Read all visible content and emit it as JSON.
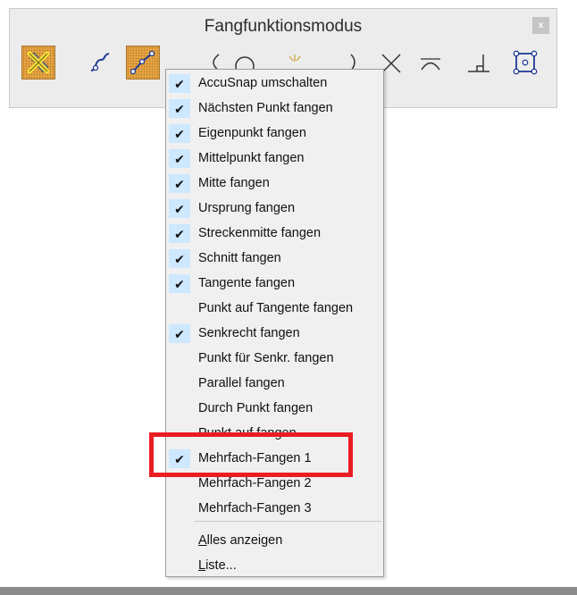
{
  "window": {
    "title": "Fangfunktionsmodus",
    "close_label": "x"
  },
  "toolbar": {
    "tools": [
      {
        "icon": "snap-toggle-icon",
        "active": true
      },
      {
        "icon": "nearest-point-icon",
        "active": false
      },
      {
        "icon": "keypoint-snap-icon",
        "active": true
      },
      {
        "icon": "midpoint-arc-icon",
        "active": false
      },
      {
        "icon": "center-circle-icon",
        "active": false
      },
      {
        "icon": "origin-icon",
        "active": false
      },
      {
        "icon": "bisector-icon",
        "active": false
      },
      {
        "icon": "intersection-icon",
        "active": false
      },
      {
        "icon": "tangent-icon",
        "active": false
      },
      {
        "icon": "perpendicular-icon",
        "active": false
      },
      {
        "icon": "multi-snap-box-icon",
        "active": false
      }
    ]
  },
  "menu": {
    "items": [
      {
        "label": "AccuSnap umschalten",
        "checked": true
      },
      {
        "label": "Nächsten Punkt fangen",
        "checked": true
      },
      {
        "label": "Eigenpunkt fangen",
        "checked": true
      },
      {
        "label": "Mittelpunkt fangen",
        "checked": true
      },
      {
        "label": "Mitte fangen",
        "checked": true
      },
      {
        "label": "Ursprung fangen",
        "checked": true
      },
      {
        "label": "Streckenmitte fangen",
        "checked": true
      },
      {
        "label": "Schnitt fangen",
        "checked": true
      },
      {
        "label": "Tangente fangen",
        "checked": true
      },
      {
        "label": "Punkt auf Tangente fangen",
        "checked": false
      },
      {
        "label": "Senkrecht fangen",
        "checked": true
      },
      {
        "label": "Punkt für Senkr. fangen",
        "checked": false
      },
      {
        "label": "Parallel fangen",
        "checked": false
      },
      {
        "label": "Durch Punkt fangen",
        "checked": false
      },
      {
        "label": "Punkt auf fangen",
        "checked": false
      },
      {
        "label": "Mehrfach-Fangen 1",
        "checked": true
      },
      {
        "label": "Mehrfach-Fangen 2",
        "checked": false
      },
      {
        "label": "Mehrfach-Fangen 3",
        "checked": false
      }
    ],
    "footer": [
      {
        "label": "Alles anzeigen"
      },
      {
        "label": "Liste..."
      }
    ],
    "check_glyph": "✔",
    "highlight_color": "#ea1c24",
    "check_bg": "#cde8ff"
  }
}
